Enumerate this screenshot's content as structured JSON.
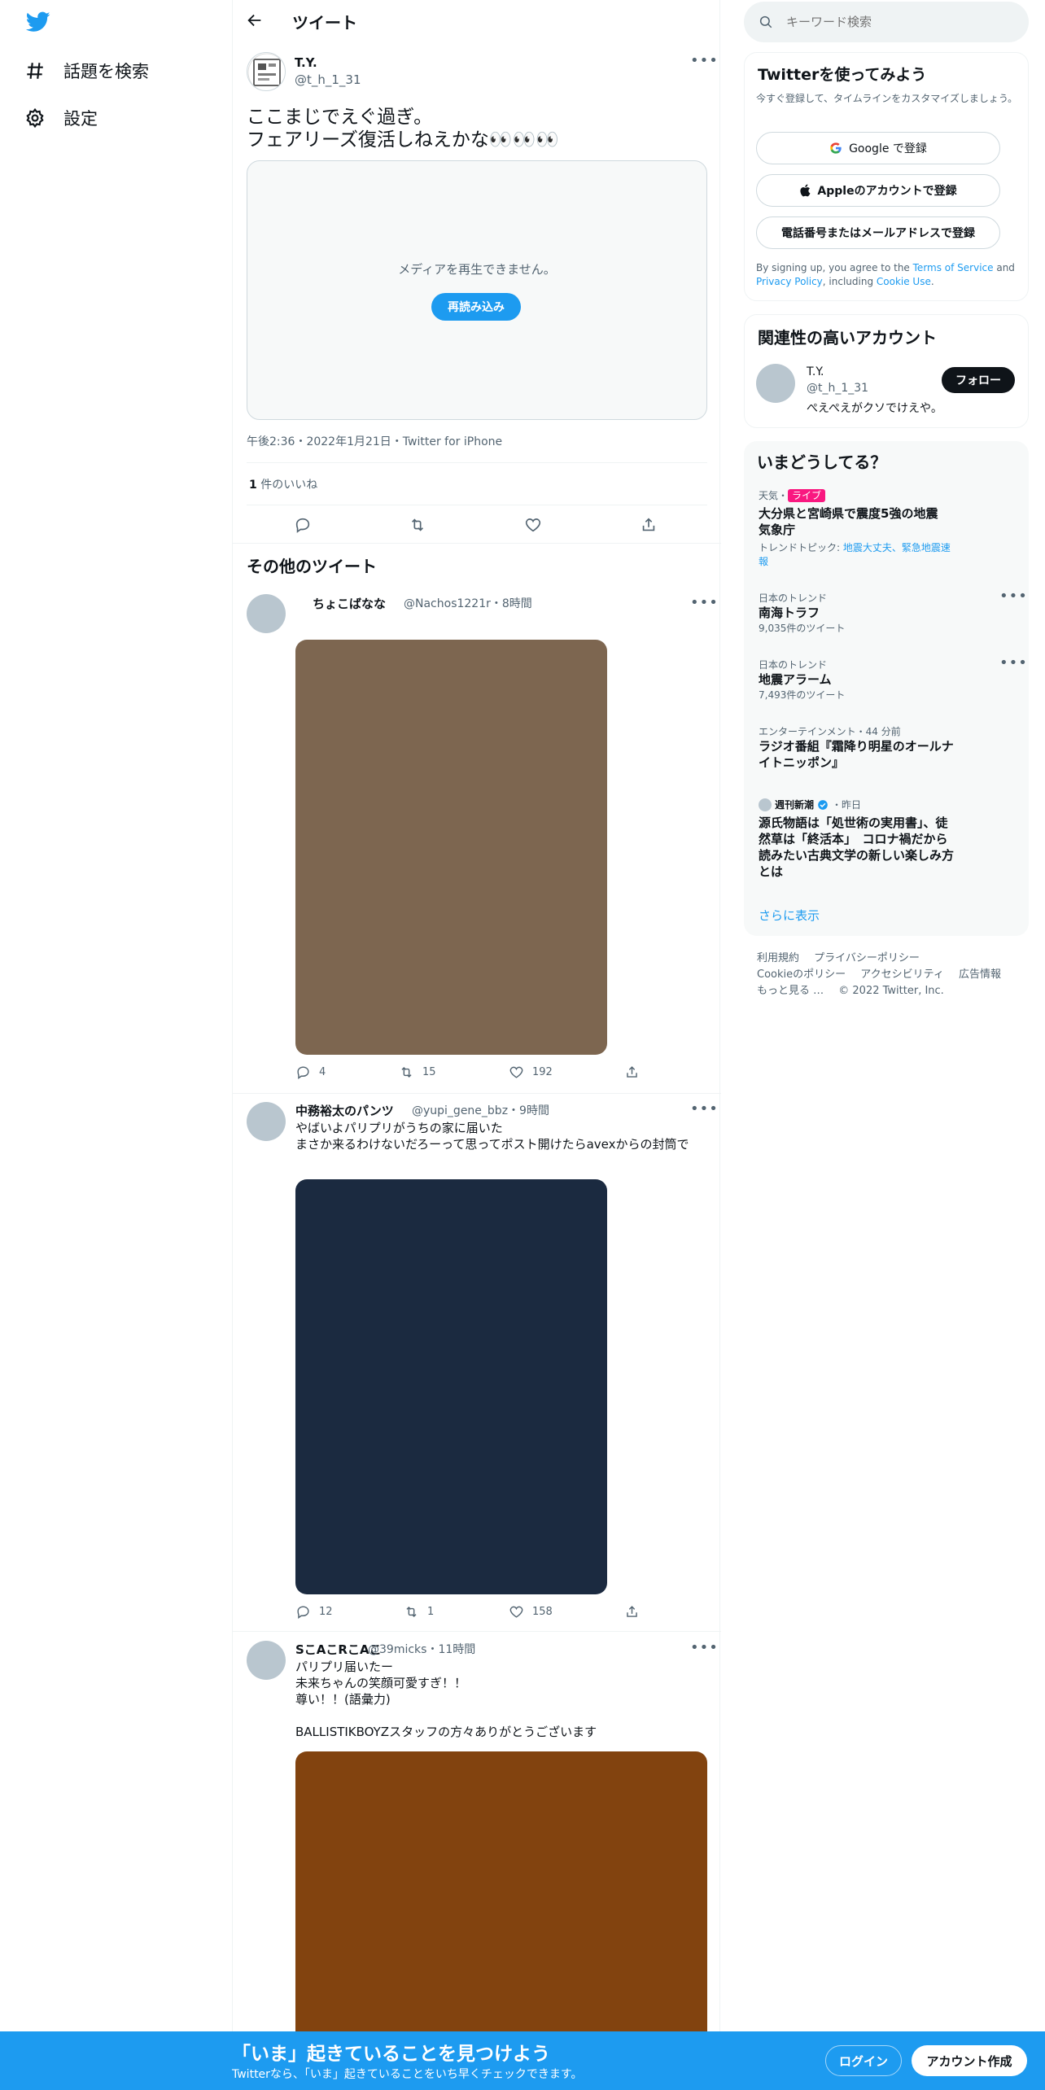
{
  "nav": {
    "explore_label": "話題を検索",
    "settings_label": "設定"
  },
  "header": {
    "title": "ツイート"
  },
  "main_tweet": {
    "display_name": "T.Y.",
    "handle": "@t_h_1_31",
    "text_line1": "ここまじでえぐ過ぎ。",
    "text_line2": "フェアリーズ復活しねえかな👀👀👀",
    "media_error": "メディアを再生できません。",
    "reload_label": "再読み込み",
    "meta": "午後2:36・2022年1月21日・Twitter for iPhone",
    "likes_count": "1",
    "likes_label": " 件のいいね"
  },
  "more_tweets_heading": "その他のツイート",
  "tweets": [
    {
      "display_name": "ちょこばなな",
      "handle": "@Nachos1221r",
      "time": "・8時間",
      "replies": "4",
      "retweets": "15",
      "likes": "192",
      "media_color": "#7d6650"
    },
    {
      "display_name": "中務裕太のパンツ",
      "handle": "@yupi_gene_bbz",
      "time": "・9時間",
      "text_line1": "やばいよパリプリがうちの家に届いた",
      "text_line2": "まさか来るわけないだろーって思ってポスト開けたらavexからの封筒で",
      "replies": "12",
      "retweets": "1",
      "likes": "158",
      "media_color": "#1b2a40"
    },
    {
      "display_name": "SこAこRこAこ",
      "handle": "@39micks",
      "time": "・11時間",
      "text_line1": "パリプリ届いたー",
      "text_line2": "未来ちゃんの笑顔可愛すぎ！！",
      "text_line3": "尊い！！(語彙力)",
      "text_line4": "BALLISTIKBOYZスタッフの方々ありがとうございます",
      "media_color": "#82430f"
    }
  ],
  "search": {
    "placeholder": "キーワード検索"
  },
  "signup": {
    "title": "Twitterを使ってみよう",
    "subtitle": "今すぐ登録して、タイムラインをカスタマイズしましょう。",
    "google_label": "Google で登録",
    "apple_label": "Appleのアカウントで登録",
    "phone_label": "電話番号またはメールアドレスで登録",
    "legal_1": "By signing up, you agree to the ",
    "terms": "Terms of Service",
    "legal_2": " and ",
    "privacy": "Privacy Policy",
    "legal_3": ", including ",
    "cookie": "Cookie Use",
    "legal_4": "."
  },
  "related": {
    "title": "関連性の高いアカウント",
    "display_name": "T.Y.",
    "handle": "@t_h_1_31",
    "bio": "ぺえぺえがクソでけえや。",
    "follow_label": "フォロー"
  },
  "trends": {
    "title": "いまどうしてる？",
    "items": [
      {
        "category": "天気・",
        "live": "ライブ",
        "title": "大分県と宮崎県で震度5強の地震",
        "subtitle": "気象庁",
        "topic_label": "トレンドトピック: ",
        "topic_links": "地震大丈夫、緊急地震速報"
      },
      {
        "category": "日本のトレンド",
        "title": "南海トラフ",
        "count": "9,035件のツイート"
      },
      {
        "category": "日本のトレンド",
        "title": "地震アラーム",
        "count": "7,493件のツイート"
      },
      {
        "category": "エンターテインメント・44 分前",
        "title": "ラジオ番組『霜降り明星のオールナイトニッポン』"
      },
      {
        "source": "週刊新潮",
        "time": "・昨日",
        "title": "源氏物語は「処世術の実用書」、徒然草は「終活本」　コロナ禍だから読みたい古典文学の新しい楽しみ方とは"
      }
    ],
    "show_more": "さらに表示"
  },
  "footer": {
    "links": [
      "利用規約",
      "プライバシーポリシー",
      "Cookieのポリシー",
      "アクセシビリティ",
      "広告情報",
      "もっと見る …"
    ],
    "copyright": "© 2022 Twitter, Inc."
  },
  "bottom_bar": {
    "title": "「いま」起きていることを見つけよう",
    "subtitle": "Twitterなら、「いま」起きていることをいち早くチェックできます。",
    "login_label": "ログイン",
    "signup_label": "アカウント作成"
  },
  "colors": {
    "accent": "#1d9bf0",
    "live_badge": "#f91880"
  }
}
